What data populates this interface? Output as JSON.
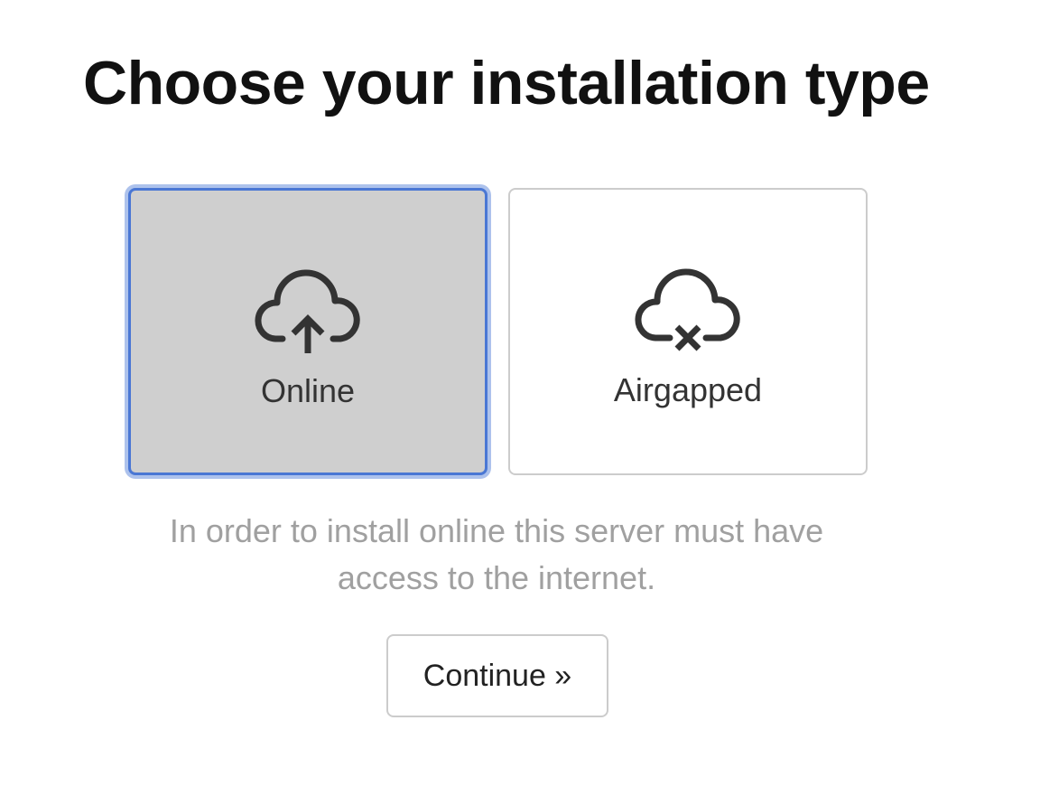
{
  "page": {
    "title": "Choose your installation type"
  },
  "options": [
    {
      "label": "Online",
      "icon": "cloud-upload-icon",
      "selected": true
    },
    {
      "label": "Airgapped",
      "icon": "cloud-offline-icon",
      "selected": false
    }
  ],
  "description": "In order to install online this server must have access to the internet.",
  "actions": {
    "continue_label": "Continue »"
  },
  "colors": {
    "selected_border": "#4a77d4",
    "selected_background": "#cfcfcf",
    "description_text": "#a0a0a0"
  }
}
